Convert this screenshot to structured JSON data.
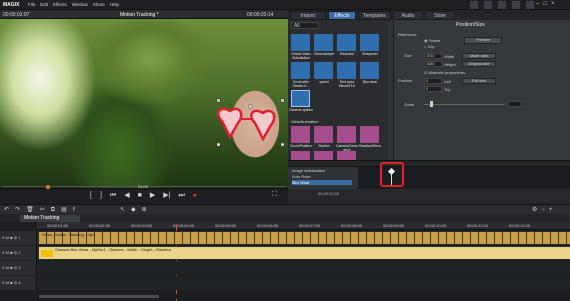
{
  "app": {
    "logo": "MAGIX",
    "menu": [
      "File",
      "Edit",
      "Effects",
      "Window",
      "Share",
      "Help"
    ]
  },
  "preview": {
    "timecode_left": "00:00:03:07",
    "title": "Motion Tracking *",
    "timecode_right": "00:00:20:14",
    "position_marker": "01:05"
  },
  "tabs": [
    "Import",
    "Effects",
    "Templates",
    "Audio",
    "Store"
  ],
  "effects": {
    "category_select": "All",
    "tiles": [
      {
        "label": "Global Video Substitution",
        "color": "blue"
      },
      {
        "label": "Chromakeyer",
        "color": "blue"
      },
      {
        "label": "Distortion",
        "color": "blue"
      },
      {
        "label": "Sharpener",
        "color": "blue"
      },
      {
        "label": "Scroll after Stretch-E...",
        "color": "blue"
      },
      {
        "label": "speed",
        "color": "blue"
      },
      {
        "label": "Red eyes Microfil 3.5",
        "color": "blue"
      },
      {
        "label": "Blur wear",
        "color": "blue"
      },
      {
        "label": "General options",
        "color": "blue"
      }
    ],
    "section2": "View/Animation",
    "tiles2": [
      {
        "label": "Zoom/Position",
        "color": "pink"
      },
      {
        "label": "Section",
        "color": "pink"
      },
      {
        "label": "Camera/Zoom drive",
        "color": "pink"
      },
      {
        "label": "Rotation/Mirror",
        "color": "pink"
      }
    ]
  },
  "props": {
    "title": "Position/Size",
    "reference": "Reference:",
    "radio1": "Frame",
    "radio2": "Clip",
    "preview_btn": "Preview",
    "size_label": "Size",
    "width": "1920",
    "width_unit": "Width",
    "height": "1080",
    "height_unit": "Height",
    "btn_mode": "Mode ratio",
    "btn_original": "Original size",
    "keep_label": "Maintain proportions",
    "position_label": "Position",
    "pos_x": "0",
    "pos_x_unit": "Left",
    "pos_y": "0",
    "pos_y_unit": "Top",
    "btn_full": "Full size",
    "zoom_label": "Zoom"
  },
  "keyframes": {
    "rows": [
      "Image stabilization",
      "Auto Ruler",
      "Blur Wear"
    ],
    "timecode": "00:00:22:00"
  },
  "timeline": {
    "tab": "Motion Tracking",
    "track1_label": "Video, Motion, Tracking, Clip1",
    "track2_label": "Glasses Blur Wear - MyRm1 - Glasses - Width - Height - Rotation"
  },
  "ruler": [
    "00:00:01:00",
    "00:00:02:00",
    "00:00:03:00",
    "00:00:04:00",
    "00:00:05:00",
    "00:00:06:00",
    "00:00:07:00",
    "00:00:08:00",
    "00:00:09:00",
    "00:00:10:00",
    "00:00:11:00",
    "00:00:12:00"
  ]
}
